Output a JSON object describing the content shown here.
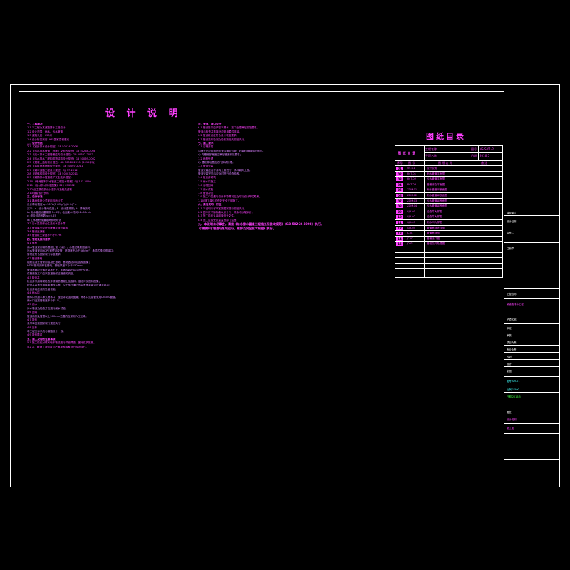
{
  "title": "设 计 说 明",
  "left_column": [
    {
      "t": "h",
      "text": "一、工程概况"
    },
    {
      "t": "body",
      "text": "1.1  本工程为某道路排水工程设计"
    },
    {
      "t": "body",
      "text": "1.2  设计范围：雨水、污水管道"
    },
    {
      "t": "body",
      "text": "1.3  道路长度：650米"
    },
    {
      "t": "body",
      "text": "1.4  设计标高采用1985国家高程基准"
    },
    {
      "t": "h",
      "text": "二、设计依据"
    },
    {
      "t": "body",
      "text": "2.1  《室外排水设计规范》GB 50014-2006"
    },
    {
      "t": "body",
      "text": "2.2  《给水排水管道工程施工及验收规范》GB 50268-2008"
    },
    {
      "t": "body",
      "text": "2.3  《给水排水工程管道结构设计规范》GB 50332-2002"
    },
    {
      "t": "body",
      "text": "2.4  《给水排水工程构筑物结构设计规范》GB 50069-2002"
    },
    {
      "t": "body",
      "text": "2.5  《混凝土结构设计规范》GB 50010-2010（2015年版）"
    },
    {
      "t": "body",
      "text": "2.6  《建筑地基基础设计规范》GB 50007-2011"
    },
    {
      "t": "body",
      "text": "2.7  《城市道路工程设计规范》CJJ 37-2012"
    },
    {
      "t": "body",
      "text": "2.8  《砌体结构设计规范》GB 50003-2011"
    },
    {
      "t": "body",
      "text": "2.9  《城镇排水管道维护安全技术规程》"
    },
    {
      "t": "body",
      "text": "2.10 《埋地塑料排水管道工程技术规程》CJJ 143-2010"
    },
    {
      "t": "body",
      "text": "2.11 《给水排水标准图集》S2 / 05S502"
    },
    {
      "t": "body",
      "text": "2.12 业主提供的设计委托书及相关资料"
    },
    {
      "t": "body",
      "text": "2.13 道路设计资料"
    },
    {
      "t": "h",
      "text": "三、设计标准"
    },
    {
      "t": "body",
      "text": "3.1  暴雨强度公式采用当地公式"
    },
    {
      "t": "sub",
      "text": "       设计暴雨强度 q=167A(1+ClgP)/(t+b)^n"
    },
    {
      "t": "sub",
      "text": "       式中：q—设计暴雨强度；P—设计重现期；t—降雨历时"
    },
    {
      "t": "sub",
      "text": "       b) 雨水管设计重现期 P=3年，地面集水时间 t1=10min"
    },
    {
      "t": "sub",
      "text": "       c) 综合径流系数 ψ=0.65"
    },
    {
      "t": "sub",
      "text": "       d) 汇水面积按道路两侧地块计"
    },
    {
      "t": "body",
      "text": "3.2  污水量按综合生活污水量计算"
    },
    {
      "t": "body",
      "text": "3.3  管道最小设计流速满足规范要求"
    },
    {
      "t": "body",
      "text": "3.4  管道充满度"
    },
    {
      "t": "body",
      "text": "3.5  管道覆土深度不小于0.7m"
    },
    {
      "t": "h",
      "text": "四、管材及接口要求"
    },
    {
      "t": "body",
      "text": "4.1  管材"
    },
    {
      "t": "sub",
      "text": "       雨水管道采用钢筋混凝土管（Ⅱ级），承插式橡胶圈接口；"
    },
    {
      "t": "sub",
      "text": "       污水管道采用HDPE双壁波纹管，环刚度不小于8kN/m²，承插式橡胶圈接口；"
    },
    {
      "t": "sub",
      "text": "       管材应符合国家现行标准要求。"
    },
    {
      "t": "body",
      "text": "4.2  管道基础"
    },
    {
      "t": "sub",
      "text": "       钢筋混凝土管采用混凝土基础，基础做法详见国标图集；"
    },
    {
      "t": "sub",
      "text": "       HDPE管采用砂石基础，基础厚度不小于150mm；"
    },
    {
      "t": "sub",
      "text": "       管道基础应坐落在原状土上，如遇软弱土层应进行处理。"
    },
    {
      "t": "sub",
      "text": "       在管道施工中应采取措施保证管道的安全。"
    },
    {
      "t": "body",
      "text": "4.3  检查井"
    },
    {
      "t": "sub",
      "text": "       检查井采用砖砌检查井或钢筋混凝土检查井，做法详见国标图集；"
    },
    {
      "t": "sub",
      "text": "       检查井井盖采用球墨铸铁井盖，位于车行道上的井盖承载能力应满足要求；"
    },
    {
      "t": "sub",
      "text": "       检查井内应设防坠落设施。"
    },
    {
      "t": "body",
      "text": "4.4  雨水口"
    },
    {
      "t": "sub",
      "text": "       雨水口采用平箅式雨水口，做法详见国标图集；雨水口连接管采用DN300管道。"
    },
    {
      "t": "sub",
      "text": "       雨水口连接管坡度不小于1%。"
    },
    {
      "t": "body",
      "text": "4.5  闭水"
    },
    {
      "t": "sub",
      "text": "       污水管道及检查井应进行闭水试验。"
    },
    {
      "t": "body",
      "text": "4.6  回填"
    },
    {
      "t": "sub",
      "text": "       管道两侧及管顶以上500mm范围内应采用人工回填。"
    },
    {
      "t": "body",
      "text": "4.7  其他"
    },
    {
      "t": "sub",
      "text": "       未尽事宜按国家现行规范执行。"
    },
    {
      "t": "body",
      "text": "4.8  坐标"
    },
    {
      "t": "sub",
      "text": "       本工程坐标系统与道路设计一致。"
    },
    {
      "t": "body",
      "text": "4.9  其他要求"
    },
    {
      "t": "h",
      "text": "五、施工及验收注意事项"
    },
    {
      "t": "body",
      "text": "5.1  施工前应对现状地下管线进行详细调查，做好保护措施。"
    },
    {
      "t": "body",
      "text": "5.2  本工程施工及验收应严格按照国家现行规范执行。"
    }
  ],
  "mid_column": [
    {
      "t": "h",
      "text": "六、管道、接口设计"
    },
    {
      "t": "body",
      "text": "6.1  管道接口应严密不漏水，接口处理满足规范要求。"
    },
    {
      "t": "body",
      "text": "      管道与检查井连接处应采用柔性连接。"
    },
    {
      "t": "body",
      "text": "6.2  管道敷设应符合设计坡度要求。"
    },
    {
      "t": "body",
      "text": "6.3  管道变形检测及验收按相关规范执行。"
    },
    {
      "t": "h",
      "text": "七、施工要求"
    },
    {
      "t": "body",
      "text": "7.1  沟槽开挖"
    },
    {
      "t": "sub",
      "text": "       沟槽开挖应根据地质条件确定边坡，必要时采取支护措施。"
    },
    {
      "t": "sub",
      "text": "       a) 沟槽底部宽度应满足管道安装要求；"
    },
    {
      "t": "body",
      "text": "7.2  地基处理"
    },
    {
      "t": "sub",
      "text": "       b) 遇软弱地基应进行换填处理。"
    },
    {
      "t": "body",
      "text": "7.3  管道安装"
    },
    {
      "t": "sub",
      "text": "       管道安装应自下游向上游进行，承口朝向上游。"
    },
    {
      "t": "sub",
      "text": "       管道安装完毕后应及时进行检查验收。"
    },
    {
      "t": "body",
      "text": "7.4  检查井砌筑"
    },
    {
      "t": "body",
      "text": "7.5  雨水口施工"
    },
    {
      "t": "body",
      "text": "7.6  沟槽回填"
    },
    {
      "t": "body",
      "text": "7.7  闭水试验"
    },
    {
      "t": "body",
      "text": "7.8  管道冲洗"
    },
    {
      "t": "body",
      "text": "7.9  施工中如遇与设计不符情况应及时与设计单位联系。"
    },
    {
      "t": "body",
      "text": "7.10 施工单位应做好安全文明施工。"
    },
    {
      "t": "h",
      "text": "八、其他说明、附注"
    },
    {
      "t": "body",
      "text": "8.1  本说明未尽事宜按国家现行规范执行。"
    },
    {
      "t": "body",
      "text": "8.2  图中尺寸除标高以米计外，其余均以毫米计。"
    },
    {
      "t": "body",
      "text": "8.3  施工前应认真阅读设计文件。"
    },
    {
      "t": "body",
      "text": "8.4  施工应接受质量监督部门监督。"
    },
    {
      "t": "em",
      "text": "九、本说明未尽事宜，请按《给水排水管道工程施工及验收规范》（GB 50268-2008）执行。"
    },
    {
      "t": "em",
      "text": "    《城镇排水管道与泵站运行、维护及安全技术规程》执行。"
    }
  ],
  "index": {
    "title": "图纸目录",
    "head": {
      "project_label": "工程名称",
      "sub_label": "子项名称",
      "no_label": "图号",
      "date_label": "日期",
      "code": "NS-S-01-2",
      "date": "2016.5",
      "name_label": "图 纸 目 录"
    },
    "cols": [
      "序号",
      "图 号",
      "图 纸 名 称",
      "备 注"
    ],
    "rows": [
      {
        "no": "01",
        "code": "SM-01",
        "name": "设计说明"
      },
      {
        "no": "02",
        "code": "PMT-01",
        "name": "雨水管道平面图"
      },
      {
        "no": "03",
        "code": "PMT-02",
        "name": "污水管道平面图"
      },
      {
        "no": "04",
        "code": "PMT-03",
        "name": "管道综合平面图"
      },
      {
        "no": "05",
        "code": "ZDM-01",
        "name": "雨水管道纵断面图"
      },
      {
        "no": "06",
        "code": "ZDM-02",
        "name": "雨水管道纵断面图"
      },
      {
        "no": "07",
        "code": "ZDM-03",
        "name": "污水管道纵断面图"
      },
      {
        "no": "08",
        "code": "ZDM-04",
        "name": "污水管道纵断面图"
      },
      {
        "no": "09",
        "code": "GJX-01",
        "name": "检查井大样图"
      },
      {
        "no": "10",
        "code": "GJX-02",
        "name": "检查井大样图"
      },
      {
        "no": "11",
        "code": "GJX-03",
        "name": "雨水口大样图"
      },
      {
        "no": "12",
        "code": "GJX-04",
        "name": "管道基础大样图"
      },
      {
        "no": "13",
        "code": "JC-01",
        "name": "管道基础图"
      },
      {
        "no": "14",
        "code": "JC-02",
        "name": "管道接口图"
      },
      {
        "no": "15",
        "code": "JD-01",
        "name": "管线交叉处理图"
      },
      {
        "no": "",
        "code": "",
        "name": ""
      },
      {
        "no": "",
        "code": "",
        "name": ""
      },
      {
        "no": "",
        "code": "",
        "name": ""
      },
      {
        "no": "",
        "code": "",
        "name": ""
      },
      {
        "no": "",
        "code": "",
        "name": ""
      }
    ]
  },
  "title_block": [
    {
      "text": "建设单位",
      "c": "w"
    },
    {
      "text": "设计证书",
      "c": "w"
    },
    {
      "text": "会签栏",
      "c": "w"
    },
    {
      "text": "注册章",
      "c": "w"
    },
    {
      "text": "工程名称",
      "c": "w"
    },
    {
      "text": "某道路排水工程",
      "c": "m"
    },
    {
      "text": "子项名称",
      "c": "w"
    },
    {
      "text": "审定",
      "c": "w"
    },
    {
      "text": "审核",
      "c": "w"
    },
    {
      "text": "项目负责",
      "c": "w"
    },
    {
      "text": "专业负责",
      "c": "w"
    },
    {
      "text": "校对",
      "c": "w"
    },
    {
      "text": "设计",
      "c": "w"
    },
    {
      "text": "制图",
      "c": "w"
    },
    {
      "text": "图号 SM-01",
      "c": "c"
    },
    {
      "text": "比例 1:500",
      "c": "c"
    },
    {
      "text": "日期 2016.5",
      "c": "g"
    },
    {
      "text": "图名",
      "c": "w"
    },
    {
      "text": "设计说明",
      "c": "m"
    },
    {
      "text": "施工图",
      "c": "m"
    }
  ]
}
